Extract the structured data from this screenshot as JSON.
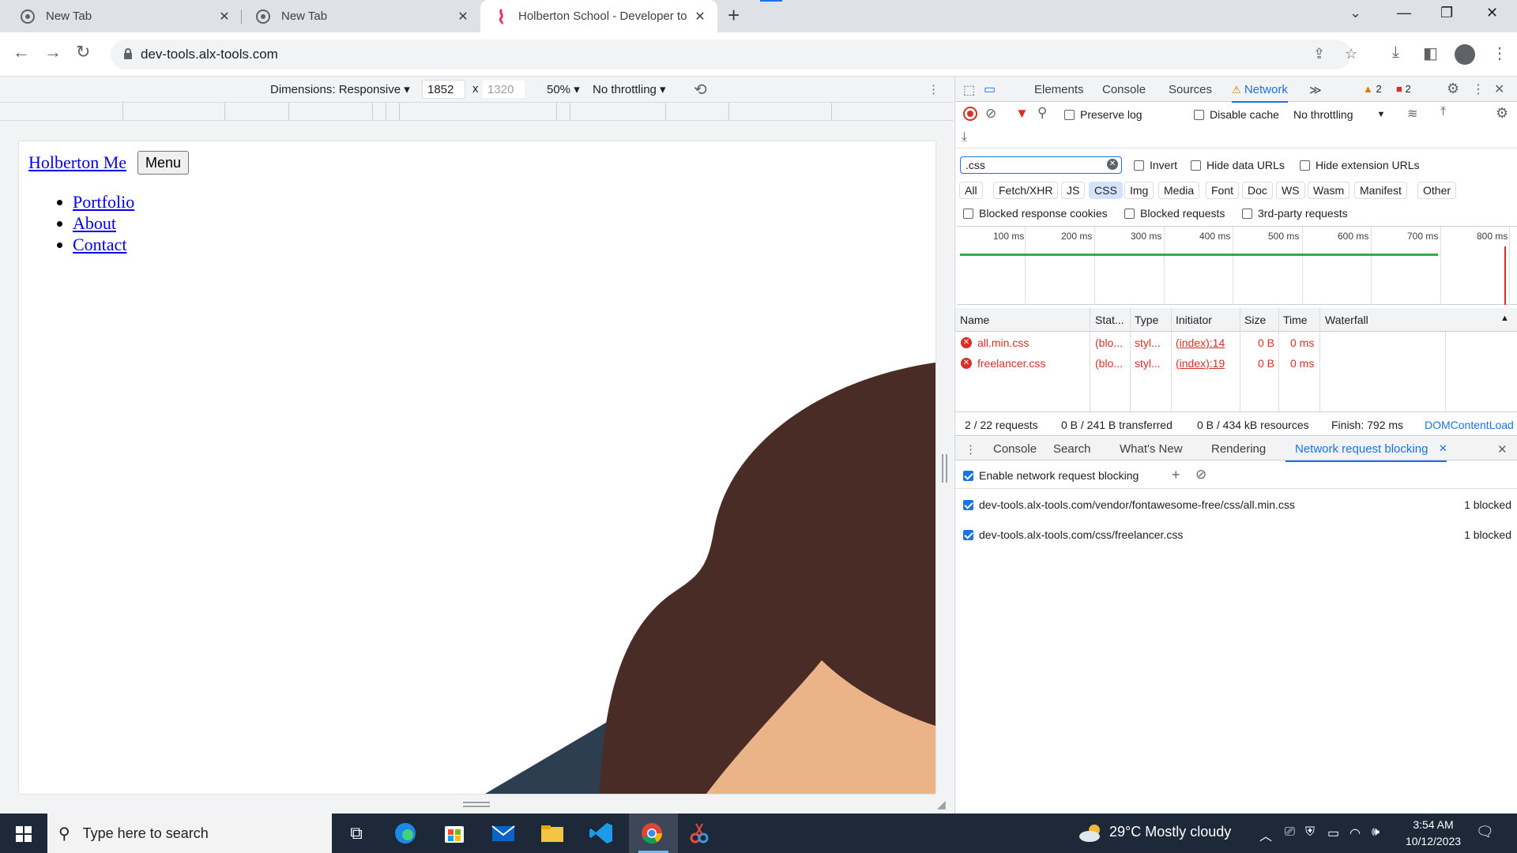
{
  "browser": {
    "tabs": [
      {
        "title": "New Tab",
        "active": false
      },
      {
        "title": "New Tab",
        "active": false
      },
      {
        "title": "Holberton School - Developer to",
        "active": true
      }
    ],
    "url": "dev-tools.alx-tools.com"
  },
  "device_toolbar": {
    "dimensions_label": "Dimensions: Responsive",
    "width": "1852",
    "times": "x",
    "height_placeholder": "1320",
    "zoom": "50%",
    "throttling": "No throttling"
  },
  "site": {
    "brand": "Holberton Me",
    "menu_button": "Menu",
    "nav": [
      "Portfolio",
      "About",
      "Contact"
    ]
  },
  "devtools": {
    "tabs": [
      "Elements",
      "Console",
      "Sources",
      "Network"
    ],
    "active_tab": "Network",
    "warnings": "2",
    "errors": "2",
    "toolbar": {
      "preserve_log": "Preserve log",
      "disable_cache": "Disable cache",
      "throttling": "No throttling"
    },
    "filter_value": ".css",
    "filter_options": [
      "Invert",
      "Hide data URLs",
      "Hide extension URLs"
    ],
    "type_filters": [
      "All",
      "Fetch/XHR",
      "JS",
      "CSS",
      "Img",
      "Media",
      "Font",
      "Doc",
      "WS",
      "Wasm",
      "Manifest",
      "Other"
    ],
    "selected_type": "CSS",
    "blocked_options": [
      "Blocked response cookies",
      "Blocked requests",
      "3rd-party requests"
    ],
    "timeline_ticks": [
      "100 ms",
      "200 ms",
      "300 ms",
      "400 ms",
      "500 ms",
      "600 ms",
      "700 ms",
      "800 ms"
    ],
    "table": {
      "headers": [
        "Name",
        "Stat...",
        "Type",
        "Initiator",
        "Size",
        "Time",
        "Waterfall"
      ],
      "rows": [
        {
          "name": "all.min.css",
          "status": "(blo...",
          "type": "styl...",
          "initiator": "(index):14",
          "size": "0 B",
          "time": "0 ms"
        },
        {
          "name": "freelancer.css",
          "status": "(blo...",
          "type": "styl...",
          "initiator": "(index):19",
          "size": "0 B",
          "time": "0 ms"
        }
      ]
    },
    "summary": {
      "requests": "2 / 22 requests",
      "transferred": "0 B / 241 B transferred",
      "resources": "0 B / 434 kB resources",
      "finish": "Finish: 792 ms",
      "dom": "DOMContentLoad"
    },
    "drawer_tabs": [
      "Console",
      "Search",
      "What's New",
      "Rendering",
      "Network request blocking"
    ],
    "drawer_active": "Network request blocking",
    "enable_blocking": "Enable network request blocking",
    "blocked_patterns": [
      {
        "pattern": "dev-tools.alx-tools.com/vendor/fontawesome-free/css/all.min.css",
        "count": "1 blocked"
      },
      {
        "pattern": "dev-tools.alx-tools.com/css/freelancer.css",
        "count": "1 blocked"
      }
    ]
  },
  "taskbar": {
    "search_placeholder": "Type here to search",
    "weather": "29°C  Mostly cloudy",
    "time": "3:54 AM",
    "date": "10/12/2023"
  },
  "colors": {
    "accent": "#1a73e8",
    "error": "#d93025",
    "illustration_hair": "#4a2c27",
    "illustration_skin": "#ebb488",
    "illustration_shirt": "#2c3e50"
  }
}
